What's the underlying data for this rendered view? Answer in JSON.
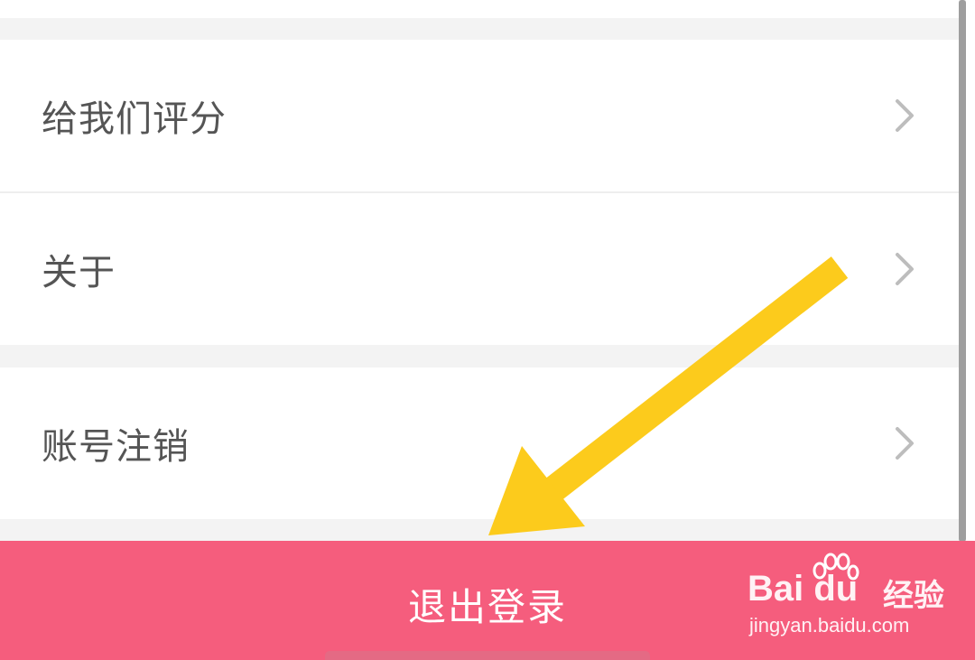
{
  "settings": {
    "items": [
      {
        "label": "给我们评分",
        "chevron_icon": "chevron-right-icon"
      },
      {
        "label": "关于",
        "chevron_icon": "chevron-right-icon"
      },
      {
        "label": "账号注销",
        "chevron_icon": "chevron-right-icon"
      }
    ]
  },
  "logout": {
    "label": "退出登录",
    "color": "#f55d7d"
  },
  "annotation": {
    "arrow_icon": "arrow-pointer-icon",
    "color": "#fccb1c"
  },
  "watermark": {
    "brand": "Bai  du",
    "product": "经验",
    "url": "jingyan.baidu.com"
  }
}
